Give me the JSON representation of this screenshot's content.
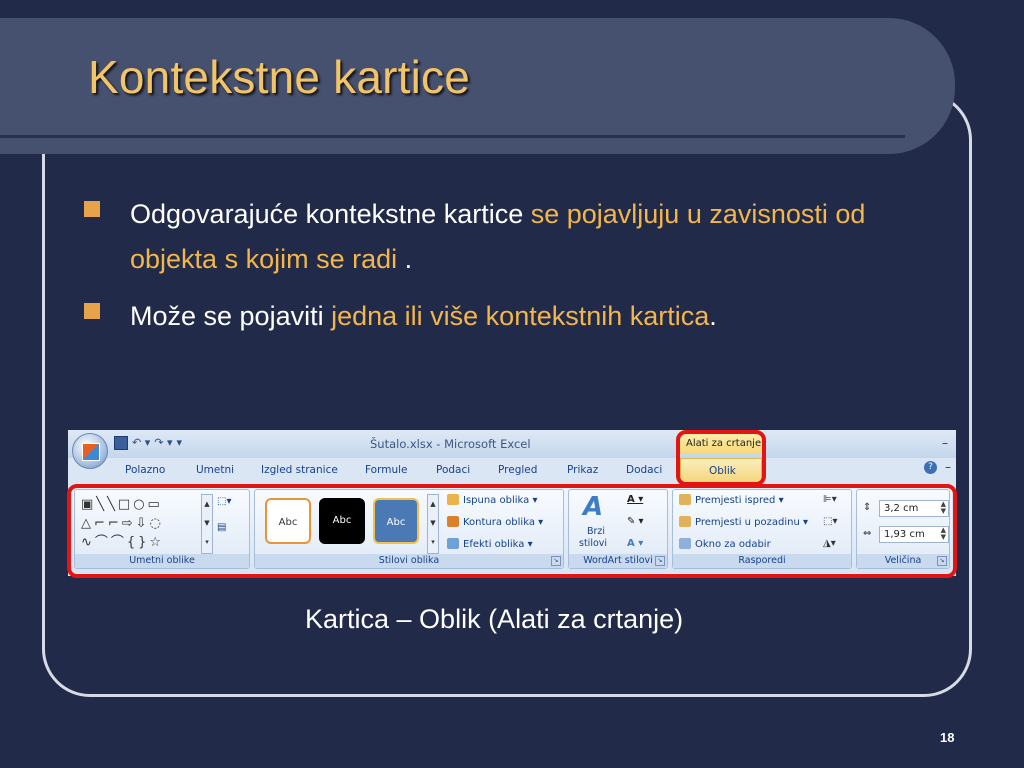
{
  "slide": {
    "title": "Kontekstne kartice",
    "bullets": [
      {
        "plain": "Odgovarajuće kontekstne kartice ",
        "highlight": "se pojavljuju u zavisnosti od objekta s kojim se radi",
        "end": " ."
      },
      {
        "plain": "Može se pojaviti ",
        "highlight": "jedna ili više kontekstnih kartica",
        "end": "."
      }
    ],
    "caption": "Kartica – Oblik (Alati za crtanje)",
    "page_number": "18"
  },
  "ribbon": {
    "window_title": "Šutalo.xlsx - Microsoft Excel",
    "contextual_tab": "Alati za crtanje",
    "tabs": [
      "Polazno",
      "Umetni",
      "Izgled stranice",
      "Formule",
      "Podaci",
      "Pregled",
      "Prikaz",
      "Dodaci"
    ],
    "active_tab": "Oblik",
    "groups": {
      "insert_shapes": "Umetni oblike",
      "shape_styles": "Stilovi oblika",
      "wordart_styles": "WordArt stilovi",
      "arrange": "Rasporedi",
      "size": "Veličina"
    },
    "style_samples": [
      "Abc",
      "Abc",
      "Abc"
    ],
    "shape_commands": {
      "fill": "Ispuna oblika",
      "outline": "Kontura oblika",
      "effects": "Efekti oblika"
    },
    "quick_styles": {
      "line1": "Brzi",
      "line2": "stilovi"
    },
    "arrange_commands": {
      "front": "Premjesti ispred",
      "back": "Premjesti u pozadinu",
      "pane": "Okno za odabir"
    },
    "size_values": {
      "height": "3,2 cm",
      "width": "1,93 cm"
    },
    "colors": {
      "accent_highlight": "#e21414",
      "tab_gold": "#f3d57d"
    }
  }
}
